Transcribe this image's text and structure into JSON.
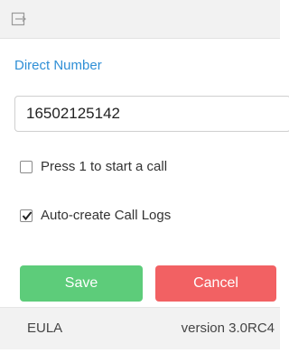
{
  "header": {
    "logout_icon": "logout-icon"
  },
  "form": {
    "label": "Direct Number",
    "number_value": "16502125142",
    "options": [
      {
        "label": "Press 1 to start a call",
        "checked": false
      },
      {
        "label": "Auto-create Call Logs",
        "checked": true
      }
    ]
  },
  "buttons": {
    "save": "Save",
    "cancel": "Cancel"
  },
  "colors": {
    "accent": "#2f8fd6",
    "save": "#5dcc7a",
    "cancel": "#f26163"
  },
  "footer": {
    "eula": "EULA",
    "version": "version 3.0RC4"
  }
}
